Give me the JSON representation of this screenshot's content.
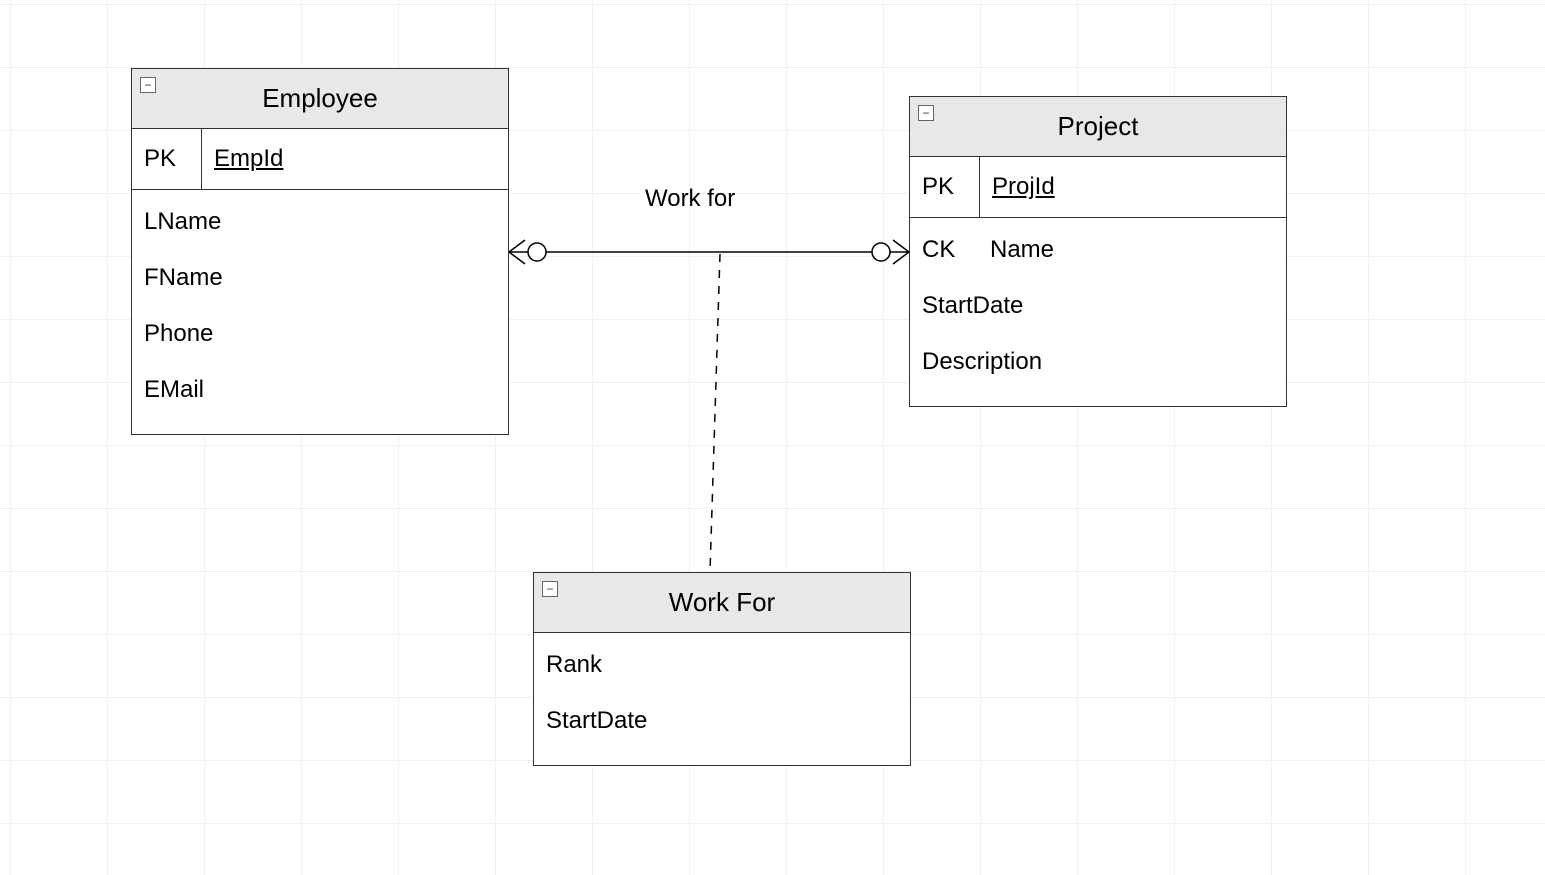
{
  "diagram_type": "entity-relationship",
  "entities": {
    "employee": {
      "title": "Employee",
      "pk_label": "PK",
      "pk_field": "EmpId",
      "attrs": [
        "LName",
        "FName",
        "Phone",
        "EMail"
      ]
    },
    "project": {
      "title": "Project",
      "pk_label": "PK",
      "pk_field": "ProjId",
      "ck_label": "CK",
      "ck_field": "Name",
      "attrs": [
        "StartDate",
        "Description"
      ]
    },
    "workfor": {
      "title": "Work For",
      "attrs": [
        "Rank",
        "StartDate"
      ]
    }
  },
  "relationship_label": "Work for",
  "collapse_glyph": "−"
}
